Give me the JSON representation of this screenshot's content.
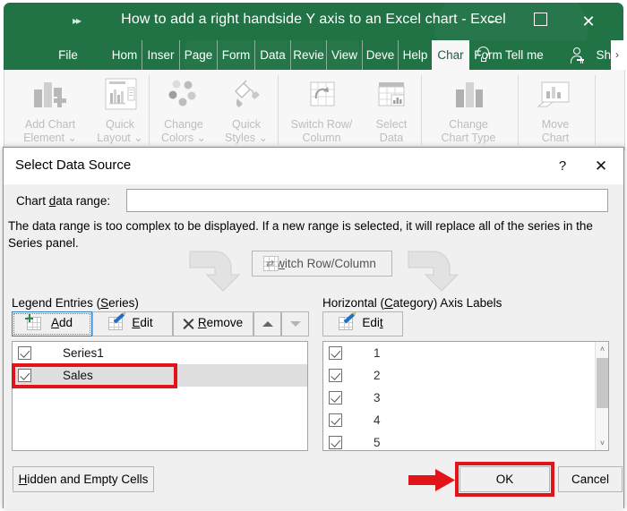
{
  "excel": {
    "title": "How to add a right handside Y axis to an Excel chart  -  Excel",
    "qat_icon": "quick-access-toolbar-icon",
    "window_buttons": {
      "minimize": "–",
      "maximize": "maximize-icon",
      "close": "✕"
    },
    "tabs": [
      {
        "label": "File",
        "active": false
      },
      {
        "label": "Hom",
        "active": false
      },
      {
        "label": "Inser",
        "active": false
      },
      {
        "label": "Page",
        "active": false
      },
      {
        "label": "Form",
        "active": false
      },
      {
        "label": "Data",
        "active": false
      },
      {
        "label": "Revie",
        "active": false
      },
      {
        "label": "View",
        "active": false
      },
      {
        "label": "Deve",
        "active": false
      },
      {
        "label": "Help",
        "active": false
      },
      {
        "label": "Char",
        "active": true
      },
      {
        "label": "Form",
        "active": false
      }
    ],
    "tell_me": "Tell me",
    "share": "Sh",
    "tabs_overflow": "›",
    "ribbon_groups": [
      {
        "items": [
          {
            "label": "Add Chart\nElement ⌄",
            "icon": "add-chart-element-icon"
          },
          {
            "label": "Quick\nLayout ⌄",
            "icon": "quick-layout-icon"
          }
        ]
      },
      {
        "items": [
          {
            "label": "Change\nColors ⌄",
            "icon": "change-colors-icon"
          },
          {
            "label": "Quick\nStyles ⌄",
            "icon": "quick-styles-icon"
          }
        ]
      },
      {
        "items": [
          {
            "label": "Switch Row/\nColumn",
            "icon": "switch-row-column-icon"
          },
          {
            "label": "Select\nData",
            "icon": "select-data-icon"
          }
        ]
      },
      {
        "items": [
          {
            "label": "Change\nChart Type",
            "icon": "change-chart-type-icon"
          }
        ]
      },
      {
        "items": [
          {
            "label": "Move\nChart",
            "icon": "move-chart-icon"
          }
        ]
      }
    ]
  },
  "dialog": {
    "title": "Select Data Source",
    "help_icon": "?",
    "close_icon": "✕",
    "chart_data_range": {
      "label_pre": "Chart ",
      "label_accel": "d",
      "label_post": "ata range:",
      "value": "",
      "placeholder": "",
      "picker_icon": "collapse-dialog-icon"
    },
    "note": "The data range is too complex to be displayed. If a new range is selected, it will replace all of the series in the Series panel.",
    "switch_button": {
      "pre": "S",
      "accel": "w",
      "post": "itch Row/Column",
      "full": "Switch Row/Column",
      "enabled": false
    },
    "legend_panel": {
      "heading_pre": "Legend Entries (",
      "heading_accel": "S",
      "heading_post": "eries)",
      "buttons": [
        {
          "name": "add",
          "pre": "",
          "accel": "A",
          "post": "dd",
          "icon": "add-icon",
          "focused": true,
          "disabled": false
        },
        {
          "name": "edit",
          "pre": "",
          "accel": "E",
          "post": "dit",
          "icon": "edit-icon",
          "focused": false,
          "disabled": false
        },
        {
          "name": "remove",
          "pre": "",
          "accel": "R",
          "post": "emove",
          "icon": "remove-icon",
          "focused": false,
          "disabled": false
        },
        {
          "name": "move-up",
          "label": "",
          "icon": "triangle-up-icon",
          "focused": false,
          "disabled": false
        },
        {
          "name": "move-down",
          "label": "",
          "icon": "triangle-down-icon",
          "focused": false,
          "disabled": true
        }
      ],
      "items": [
        {
          "label": "Series1",
          "checked": true,
          "selected": false
        },
        {
          "label": "Sales",
          "checked": true,
          "selected": true
        }
      ]
    },
    "category_panel": {
      "heading_pre": "Horizontal (",
      "heading_accel": "C",
      "heading_post": "ategory) Axis Labels",
      "edit_button": {
        "pre": "Edi",
        "accel": "t",
        "post": "",
        "full": "Edit",
        "icon": "edit-icon"
      },
      "items": [
        {
          "label": "1",
          "checked": true
        },
        {
          "label": "2",
          "checked": true
        },
        {
          "label": "3",
          "checked": true
        },
        {
          "label": "4",
          "checked": true
        },
        {
          "label": "5",
          "checked": true
        }
      ],
      "scrollbar": {
        "up_icon": "˄",
        "down_icon": "˅"
      }
    },
    "footer": {
      "hidden_cells": {
        "pre": "",
        "accel": "H",
        "post": "idden and Empty Cells",
        "full": "Hidden and Empty Cells"
      },
      "ok": "OK",
      "cancel": "Cancel"
    }
  },
  "annotations": {
    "highlight_sales": "red-rectangle-around-sales-series",
    "highlight_ok": "red-rectangle-around-ok-button",
    "arrow_to_ok": "red-arrow-pointing-to-ok-button",
    "color": "#e3131a"
  },
  "colors": {
    "excel_green": "#217346",
    "dialog_bg": "#f0f0f0",
    "selection_gray": "#dedede",
    "default_button_blue": "#e9f3fb",
    "annotation_red": "#e3131a"
  }
}
